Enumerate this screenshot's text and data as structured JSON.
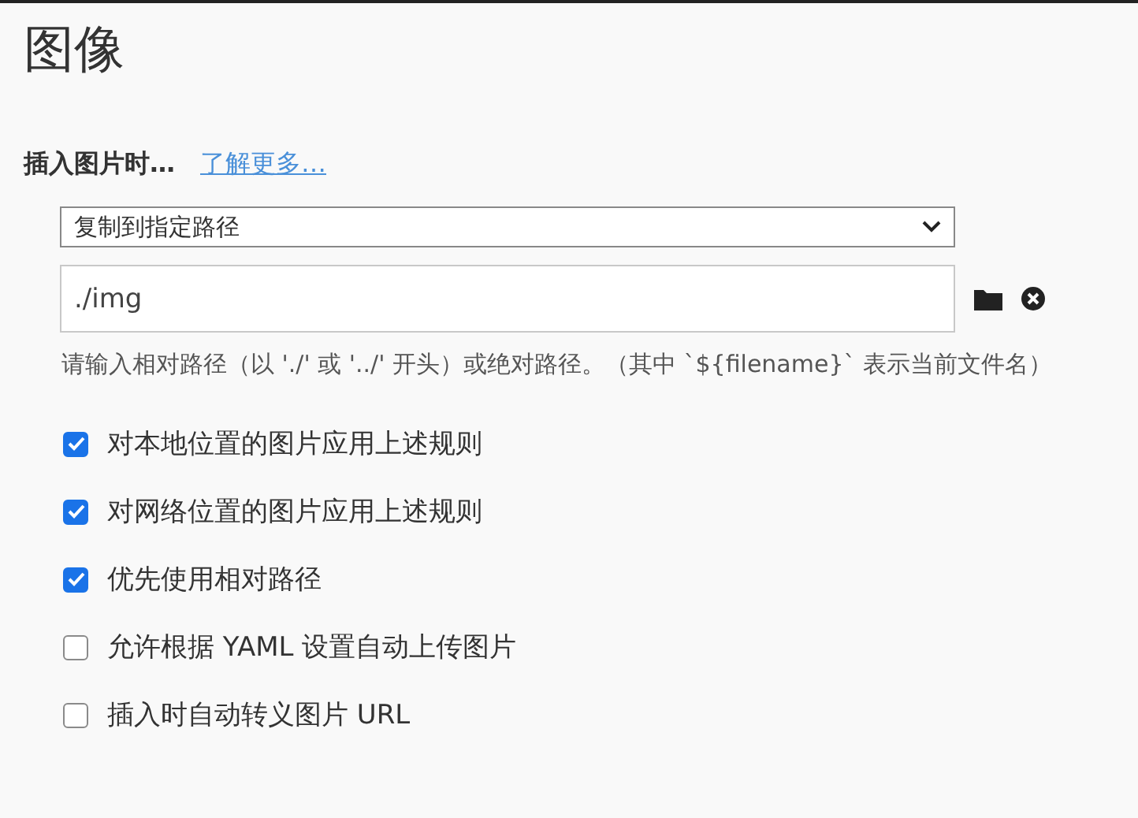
{
  "title": "图像",
  "insert_section": {
    "label": "插入图片时…",
    "link": "了解更多…"
  },
  "action_select": {
    "value": "复制到指定路径"
  },
  "path_field": {
    "value": "./img"
  },
  "hint": "请输入相对路径（以 './' 或 '../' 开头）或绝对路径。（其中 `${filename}` 表示当前文件名）",
  "options": [
    {
      "label": "对本地位置的图片应用上述规则",
      "checked": true
    },
    {
      "label": "对网络位置的图片应用上述规则",
      "checked": true
    },
    {
      "label": "优先使用相对路径",
      "checked": true
    },
    {
      "label": "允许根据 YAML 设置自动上传图片",
      "checked": false
    },
    {
      "label": "插入时自动转义图片 URL",
      "checked": false
    }
  ]
}
